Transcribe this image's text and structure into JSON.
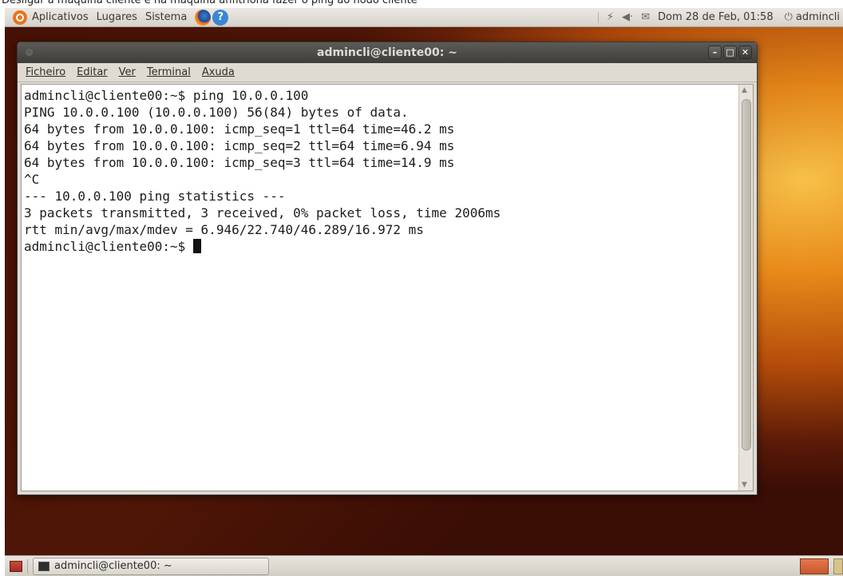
{
  "caption": "Desligar a máquina cliente e na máquina anfitriona fazer o ping ao nodo cliente",
  "top_panel": {
    "menus": [
      "Aplicativos",
      "Lugares",
      "Sistema"
    ],
    "clock": "Dom 28 de Feb, 01:58",
    "user": "admincli",
    "icons": [
      "ubuntu-logo-icon",
      "firefox-icon",
      "help-icon",
      "network-icon",
      "volume-icon",
      "mail-icon",
      "power-icon"
    ]
  },
  "window": {
    "title": "admincli@cliente00: ~",
    "menu": [
      "Ficheiro",
      "Editar",
      "Ver",
      "Terminal",
      "Axuda"
    ],
    "lines": [
      "admincli@cliente00:~$ ping 10.0.0.100",
      "PING 10.0.0.100 (10.0.0.100) 56(84) bytes of data.",
      "64 bytes from 10.0.0.100: icmp_seq=1 ttl=64 time=46.2 ms",
      "64 bytes from 10.0.0.100: icmp_seq=2 ttl=64 time=6.94 ms",
      "64 bytes from 10.0.0.100: icmp_seq=3 ttl=64 time=14.9 ms",
      "^C",
      "--- 10.0.0.100 ping statistics ---",
      "3 packets transmitted, 3 received, 0% packet loss, time 2006ms",
      "rtt min/avg/max/mdev = 6.946/22.740/46.289/16.972 ms",
      "admincli@cliente00:~$ "
    ]
  },
  "taskbar": {
    "task_label": "admincli@cliente00: ~"
  },
  "colors": {
    "wallpaper_accent": "#e88a1a",
    "titlebar": "#3e3d39",
    "terminal_bg": "#ffffff"
  }
}
